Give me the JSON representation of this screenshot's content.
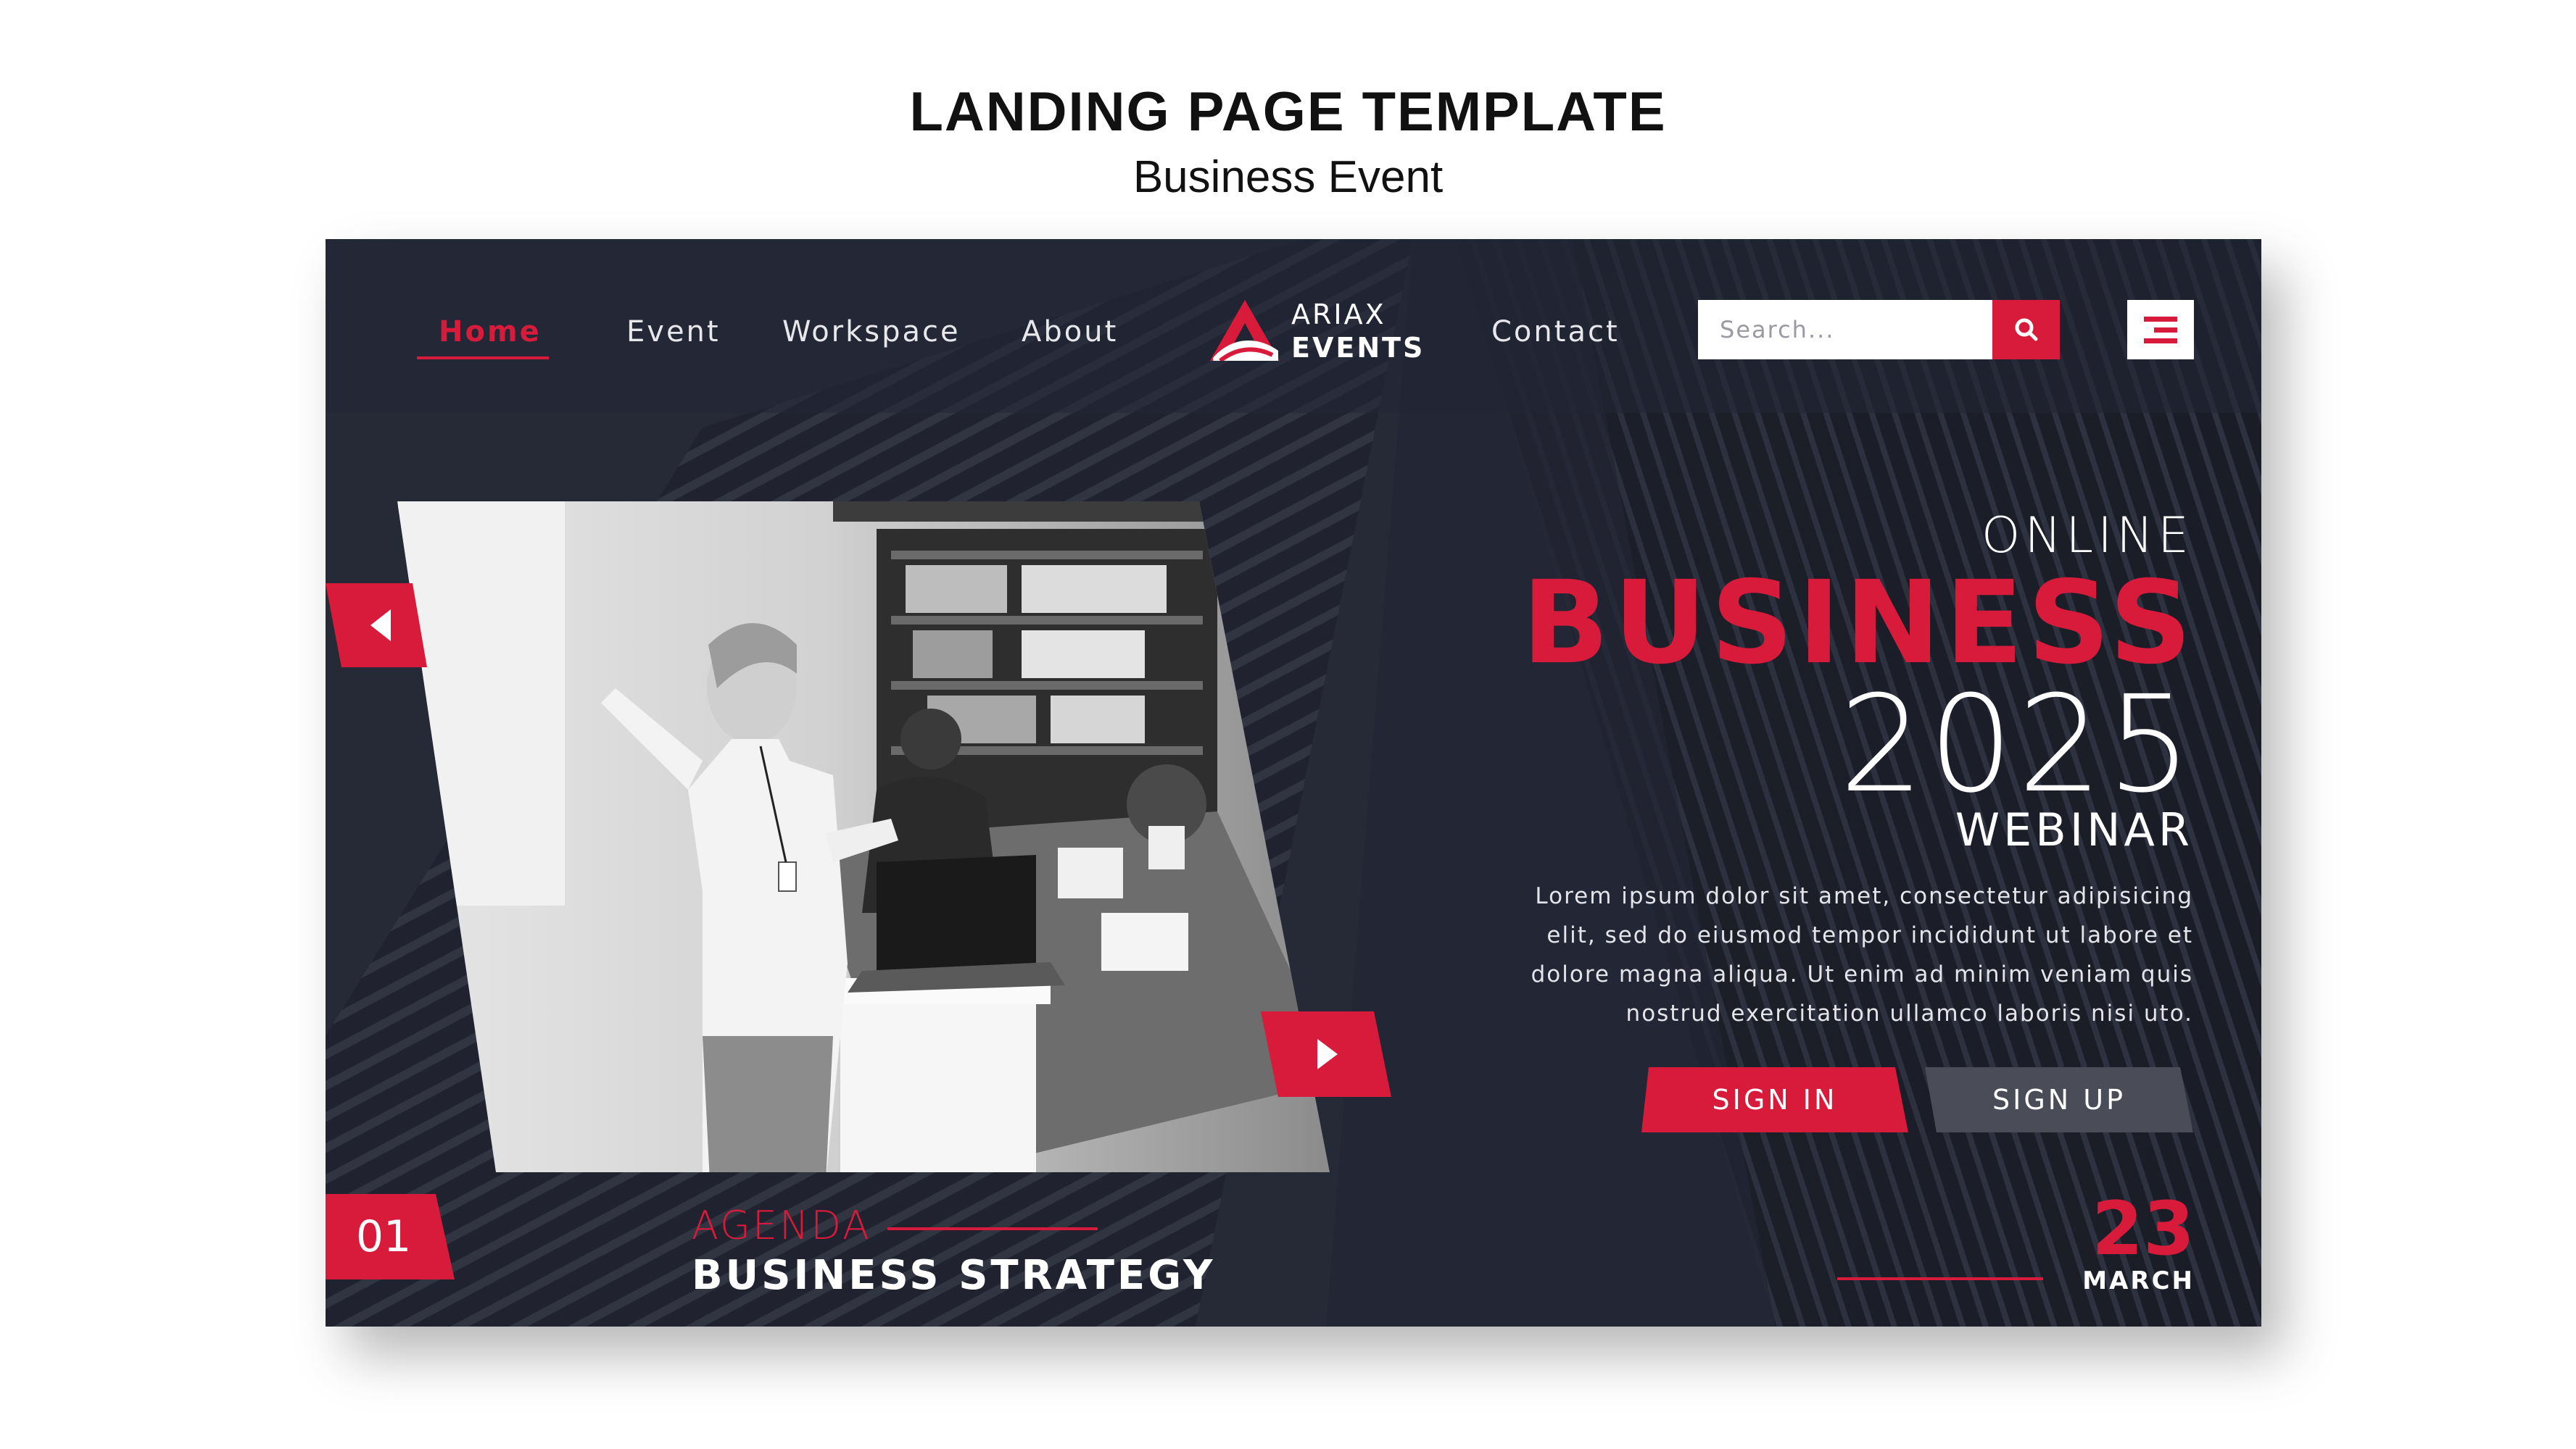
{
  "header": {
    "title": "LANDING PAGE TEMPLATE",
    "subtitle": "Business Event"
  },
  "nav": {
    "items": [
      {
        "label": "Home",
        "active": true
      },
      {
        "label": "Event",
        "active": false
      },
      {
        "label": "Workspace",
        "active": false
      },
      {
        "label": "About",
        "active": false
      },
      {
        "label": "Contact",
        "active": false
      }
    ]
  },
  "logo": {
    "line1": "ARIAX",
    "line2": "EVENTS"
  },
  "search": {
    "placeholder": "Search..."
  },
  "icons": {
    "search": "search-icon",
    "menu": "menu-icon",
    "prev": "arrow-left-icon",
    "next": "arrow-right-icon",
    "logo": "logo-a-icon"
  },
  "hero": {
    "kicker": "ONLINE",
    "headline": "BUSINESS",
    "year": "2025",
    "tagline": "WEBINAR",
    "description": "Lorem ipsum dolor sit amet, consectetur adipisicing elit, sed do eiusmod tempor incididunt ut labore et dolore magna aliqua. Ut enim ad minim veniam quis nostrud exercitation ullamco laboris nisi uto.",
    "sign_in_label": "SIGN IN",
    "sign_up_label": "SIGN UP"
  },
  "agenda": {
    "slide_number": "01",
    "label": "AGENDA",
    "title": "BUSINESS STRATEGY"
  },
  "date": {
    "day": "23",
    "month": "MARCH"
  },
  "colors": {
    "accent": "#d81b3b",
    "background": "#232634",
    "secondary_button": "#4a4d57",
    "text_light": "#ffffff"
  }
}
